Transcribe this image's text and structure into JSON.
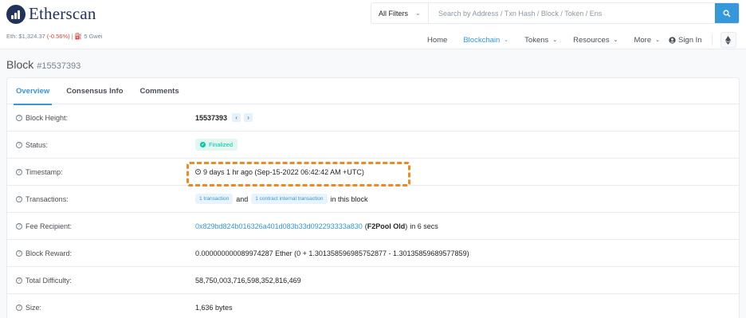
{
  "header": {
    "logo_text": "Etherscan",
    "eth_price_prefix": "Eth: $1,324.37",
    "eth_price_change": "(-0.56%)",
    "gas": "| ⛽ 5 Gwei",
    "filter_label": "All Filters",
    "search_placeholder": "Search by Address / Txn Hash / Block / Token / Ens",
    "nav": {
      "home": "Home",
      "blockchain": "Blockchain",
      "tokens": "Tokens",
      "resources": "Resources",
      "more": "More",
      "signin": "Sign In"
    },
    "accent": "#3498db"
  },
  "page": {
    "title": "Block",
    "block_number_label": "#15537393"
  },
  "tabs": [
    "Overview",
    "Consensus Info",
    "Comments"
  ],
  "rows": {
    "block_height": {
      "label": "Block Height:",
      "value": "15537393"
    },
    "status": {
      "label": "Status:",
      "value": "Finalized"
    },
    "timestamp": {
      "label": "Timestamp:",
      "value": "9 days 1 hr ago (Sep-15-2022 06:42:42 AM +UTC)"
    },
    "transactions": {
      "label": "Transactions:",
      "pill1": "1 transaction",
      "and": "and",
      "pill2": "1 contract internal transaction",
      "suffix": "in this block"
    },
    "fee_recipient": {
      "label": "Fee Recipient:",
      "address": "0x829bd824b016326a401d083b33d092293333a830",
      "name_open": "(",
      "name": "F2Pool Old",
      "name_close": ")",
      "suffix": "in 6 secs"
    },
    "block_reward": {
      "label": "Block Reward:",
      "value": "0.000000000089974287 Ether (0 + 1.301358596985752877 - 1.30135859689577859)"
    },
    "total_difficulty": {
      "label": "Total Difficulty:",
      "value": "58,750,003,716,598,352,816,469"
    },
    "size": {
      "label": "Size:",
      "value": "1,636 bytes"
    }
  },
  "annotation_color": "#f08a1d"
}
